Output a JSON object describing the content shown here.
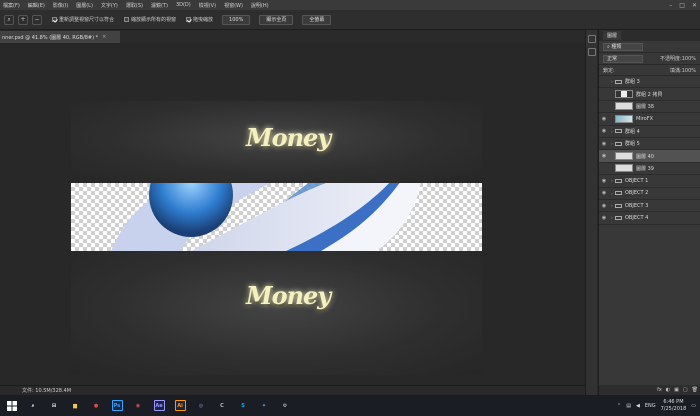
{
  "menu": [
    "檔案(F)",
    "編輯(E)",
    "影像(I)",
    "圖層(L)",
    "文字(Y)",
    "選取(S)",
    "濾鏡(T)",
    "3D(D)",
    "檢視(V)",
    "視窗(W)",
    "說明(H)"
  ],
  "window_controls": {
    "minimize": "–",
    "maximize": "□",
    "close": "✕"
  },
  "options": {
    "resize_windows_label": "重新調整視窗尺寸以符合",
    "zoom_all_label": "縮放顯示所有的視窗",
    "scrubby_zoom_label": "拖曳縮放",
    "zoom_value": "100%",
    "fit_screen_label": "顯示全頁",
    "fill_screen_label": "全螢幕"
  },
  "document_tab": {
    "title": "nner.psd @ 41.8% (圖層 40, RGB/8#) *",
    "close": "×"
  },
  "canvas": {
    "logo_text": "Money"
  },
  "status": {
    "doc_size": "文件: 10.5M/328.4M"
  },
  "layers_panel": {
    "tab_label": "圖層",
    "kind_filter": "種類",
    "blend_mode": "正常",
    "opacity_label": "不透明度:",
    "opacity_value": "100%",
    "lock_label": "鎖定:",
    "fill_label": "填滿:",
    "fill_value": "100%",
    "layers": [
      {
        "name": "群組 3",
        "type": "group",
        "visible": false
      },
      {
        "name": "群組 2 拷貝",
        "type": "layer",
        "visible": false
      },
      {
        "name": "圖層 38",
        "type": "layer",
        "visible": false
      },
      {
        "name": "MiroFX",
        "type": "layer",
        "visible": true
      },
      {
        "name": "群組 4",
        "type": "group",
        "visible": true
      },
      {
        "name": "群組 5",
        "type": "group",
        "visible": true
      },
      {
        "name": "圖層 40",
        "type": "layer",
        "visible": true,
        "selected": true
      },
      {
        "name": "圖層 39",
        "type": "layer",
        "visible": false
      },
      {
        "name": "OBJECT 1",
        "type": "group",
        "visible": true
      },
      {
        "name": "OBJECT 2",
        "type": "group",
        "visible": true
      },
      {
        "name": "OBJECT 3",
        "type": "group",
        "visible": true
      },
      {
        "name": "OBJECT 4",
        "type": "group",
        "visible": true
      }
    ],
    "footer_icons": [
      "fx",
      "◐",
      "▣",
      "▢",
      "🗑"
    ]
  },
  "taskbar": {
    "apps": [
      {
        "name": "search",
        "glyph": "⌕",
        "color": "#ffffff"
      },
      {
        "name": "task-view",
        "glyph": "⊟",
        "color": "#ffffff"
      },
      {
        "name": "explorer",
        "glyph": "▆",
        "color": "#f2c94c"
      },
      {
        "name": "chrome",
        "glyph": "●",
        "color": "#e84b3c"
      },
      {
        "name": "photoshop",
        "glyph": "Ps",
        "color": "#31a8ff"
      },
      {
        "name": "notification-app",
        "glyph": "◉",
        "color": "#d9534f"
      },
      {
        "name": "after-effects",
        "glyph": "Ae",
        "color": "#9999ff"
      },
      {
        "name": "illustrator",
        "glyph": "Ai",
        "color": "#ff9a00"
      },
      {
        "name": "app-circle",
        "glyph": "◎",
        "color": "#7b9bd6"
      },
      {
        "name": "app-c",
        "glyph": "C",
        "color": "#bbbbbb"
      },
      {
        "name": "skype",
        "glyph": "S",
        "color": "#00aff0"
      },
      {
        "name": "app-star",
        "glyph": "✦",
        "color": "#44aadd"
      },
      {
        "name": "app-gear",
        "glyph": "⚙",
        "color": "#cccccc"
      }
    ],
    "lang": "ENG",
    "time": "6:46 PM",
    "date": "7/25/2018"
  }
}
